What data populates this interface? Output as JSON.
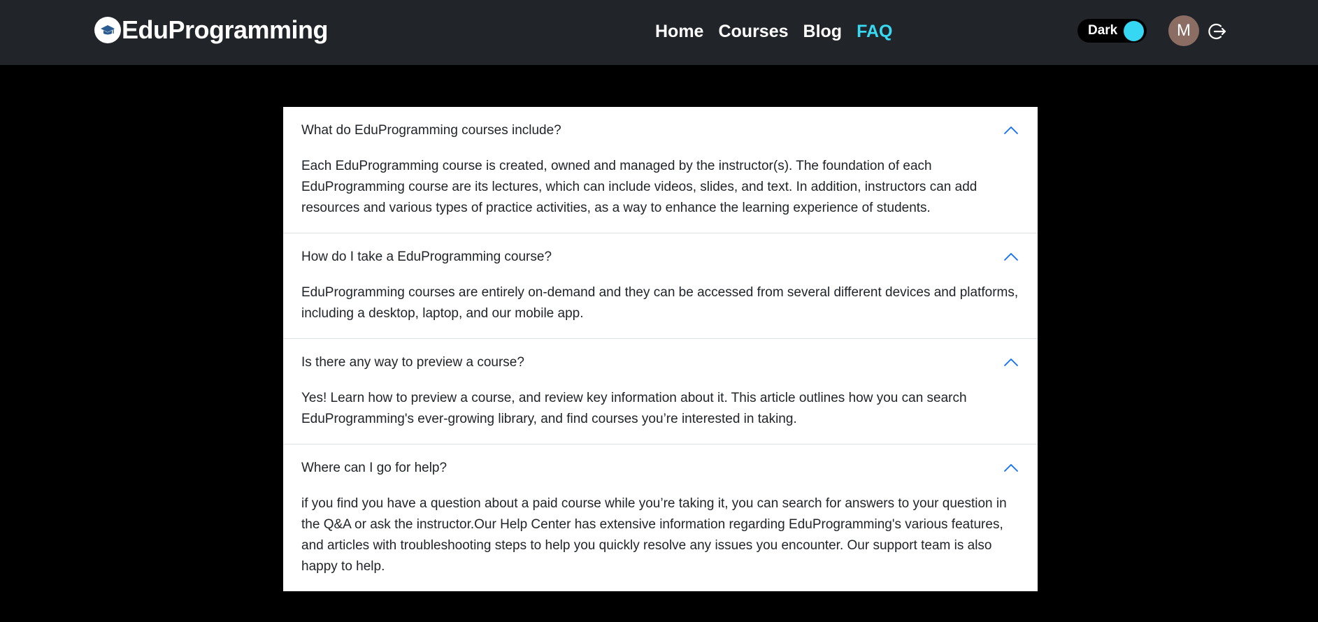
{
  "brand": {
    "name": "EduProgramming",
    "logo_icon": "graduation-cap-icon"
  },
  "nav": {
    "links": [
      {
        "label": "Home",
        "active": false
      },
      {
        "label": "Courses",
        "active": false
      },
      {
        "label": "Blog",
        "active": false
      },
      {
        "label": "FAQ",
        "active": true
      }
    ]
  },
  "theme_toggle": {
    "label": "Dark",
    "knob_color": "#36d7f2"
  },
  "user": {
    "avatar_initial": "M",
    "avatar_color": "#8b6d64",
    "logout_icon": "logout-icon"
  },
  "colors": {
    "navbar_bg": "#212529",
    "page_bg": "#000000",
    "accent": "#38d9f3",
    "chevron": "#0d6efd"
  },
  "faq": [
    {
      "question": "What do EduProgramming courses include?",
      "answer": "Each EduProgramming course is created, owned and managed by the instructor(s). The foundation of each EduProgramming course are its lectures, which can include videos, slides, and text. In addition, instructors can add resources and various types of practice activities, as a way to enhance the learning experience of students."
    },
    {
      "question": "How do I take a EduProgramming course?",
      "answer": "EduProgramming courses are entirely on-demand and they can be accessed from several different devices and platforms, including a desktop, laptop, and our mobile app."
    },
    {
      "question": "Is there any way to preview a course?",
      "answer": "Yes! Learn how to preview a course, and review key information about it. This article outlines how you can search EduProgramming's ever-growing library, and find courses you’re interested in taking."
    },
    {
      "question": "Where can I go for help?",
      "answer": "if you find you have a question about a paid course while you’re taking it, you can search for answers to your question in the Q&A or ask the instructor.Our Help Center has extensive information regarding EduProgramming's various features, and articles with troubleshooting steps to help you quickly resolve any issues you encounter. Our support team is also happy to help."
    }
  ]
}
